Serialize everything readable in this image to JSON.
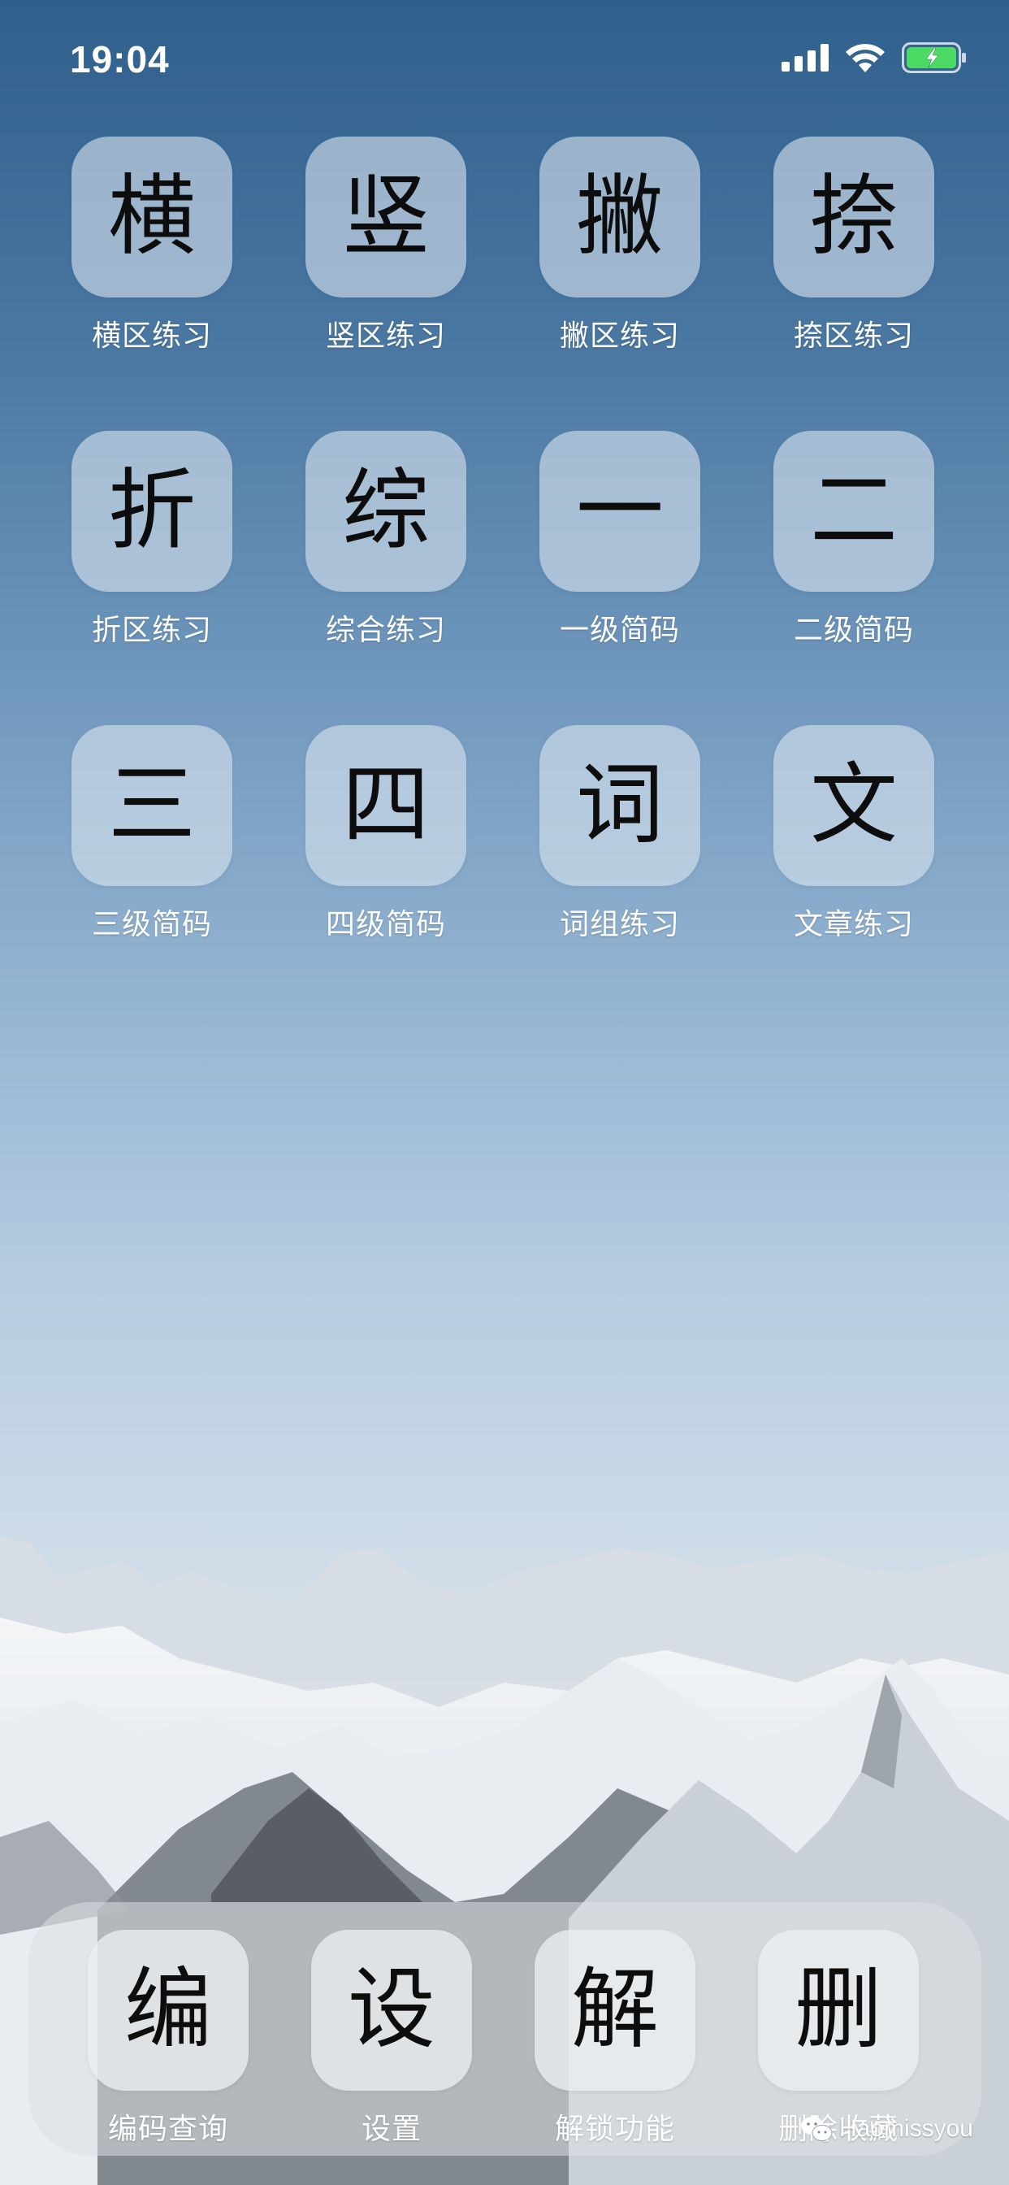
{
  "status_bar": {
    "time": "19:04",
    "icons": [
      "signal-icon",
      "wifi-icon",
      "battery-charging-icon"
    ],
    "battery_color": "#4cd964"
  },
  "apps": [
    {
      "glyph": "横",
      "label": "横区练习"
    },
    {
      "glyph": "竖",
      "label": "竖区练习"
    },
    {
      "glyph": "撇",
      "label": "撇区练习"
    },
    {
      "glyph": "捺",
      "label": "捺区练习"
    },
    {
      "glyph": "折",
      "label": "折区练习"
    },
    {
      "glyph": "综",
      "label": "综合练习"
    },
    {
      "glyph": "一",
      "label": "一级简码"
    },
    {
      "glyph": "二",
      "label": "二级简码"
    },
    {
      "glyph": "三",
      "label": "三级简码"
    },
    {
      "glyph": "四",
      "label": "四级简码"
    },
    {
      "glyph": "词",
      "label": "词组练习"
    },
    {
      "glyph": "文",
      "label": "文章练习"
    }
  ],
  "dock": [
    {
      "glyph": "编",
      "label": "编码查询"
    },
    {
      "glyph": "设",
      "label": "设置"
    },
    {
      "glyph": "解",
      "label": "解锁功能"
    },
    {
      "glyph": "删",
      "label": "删除收藏"
    }
  ],
  "watermark": {
    "text": "Haomissyou",
    "icon": "wechat-icon"
  }
}
